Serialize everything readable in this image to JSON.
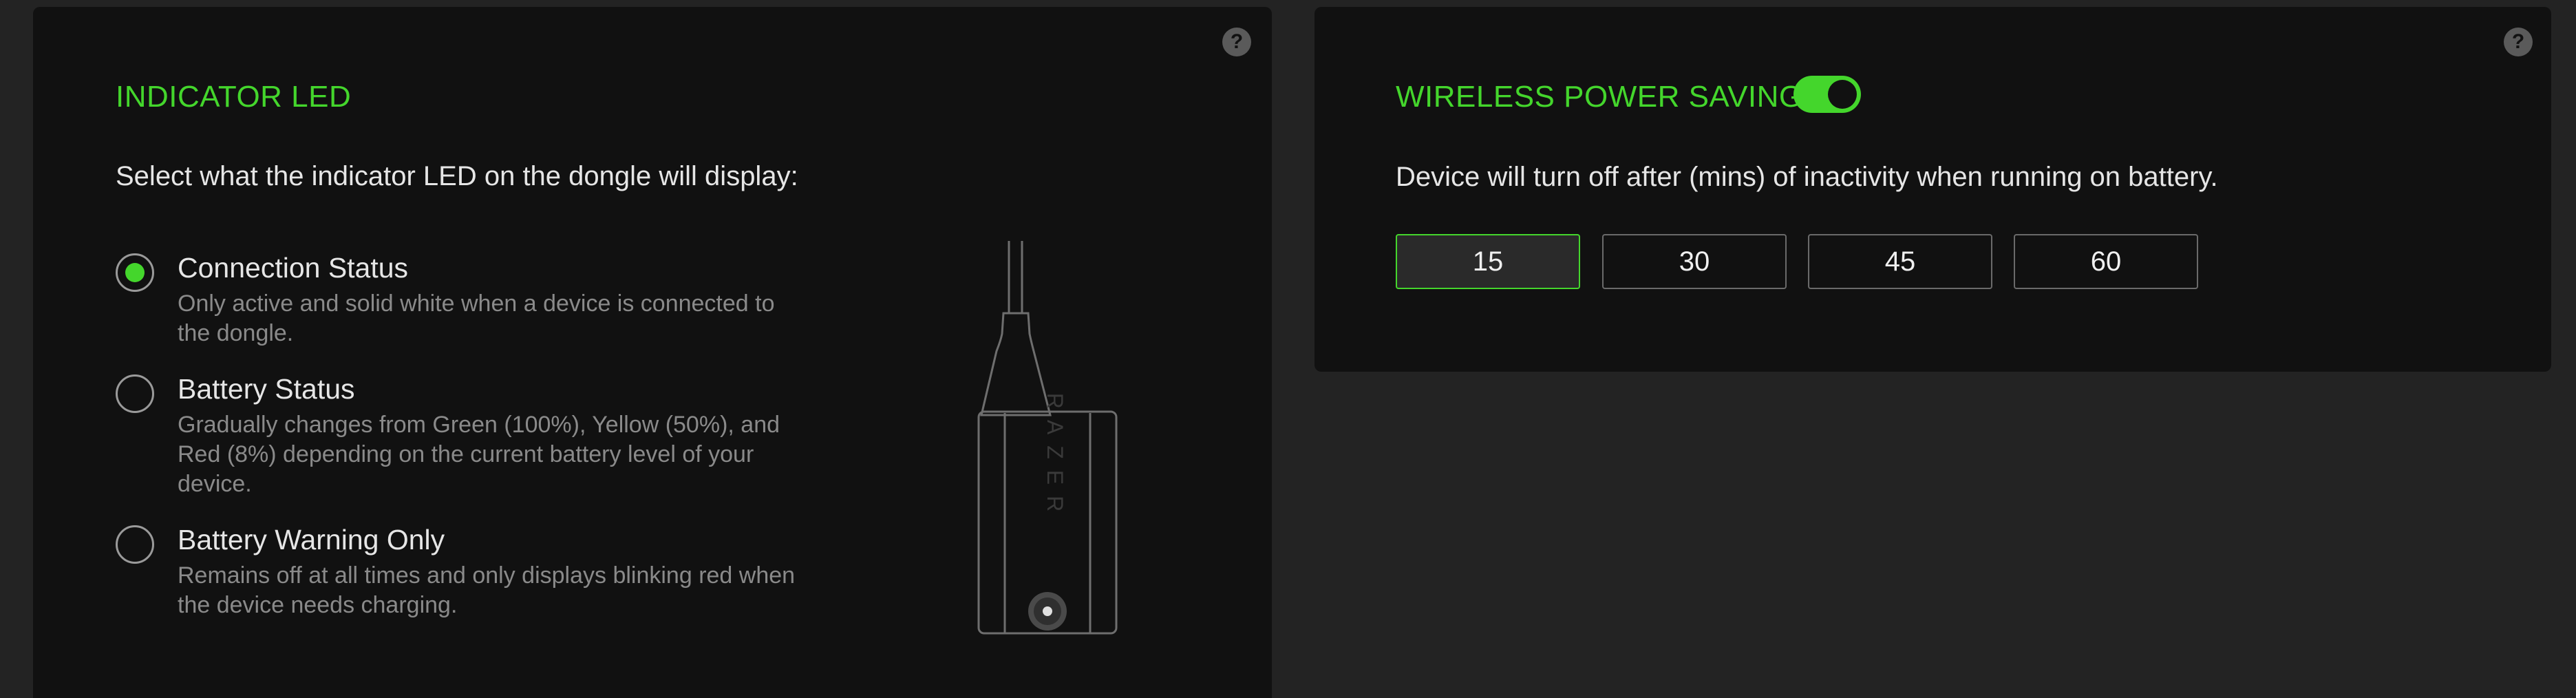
{
  "indicator_led": {
    "title": "INDICATOR LED",
    "description": "Select what the indicator LED on the dongle will display:",
    "help_label": "?",
    "options": [
      {
        "label": "Connection Status",
        "help": "Only active and solid white when a device is connected to the dongle.",
        "selected": true
      },
      {
        "label": "Battery Status",
        "help": "Gradually changes from Green (100%), Yellow (50%), and Red (8%) depending on the current battery level of your device.",
        "selected": false
      },
      {
        "label": "Battery Warning Only",
        "help": "Remains off at all times and only displays blinking red when the device needs charging.",
        "selected": false
      }
    ],
    "dongle_brand": "RAZER"
  },
  "wireless_power_saving": {
    "title": "WIRELESS POWER SAVING",
    "enabled": true,
    "description": "Device will turn off after (mins) of inactivity when running on battery.",
    "help_label": "?",
    "options": [
      "15",
      "30",
      "45",
      "60"
    ],
    "selected": "15"
  },
  "colors": {
    "accent": "#44d62c",
    "panel": "#111111",
    "background": "#232323"
  },
  "icons": {
    "help": "help-icon",
    "dongle": "dongle-illustration-icon"
  }
}
